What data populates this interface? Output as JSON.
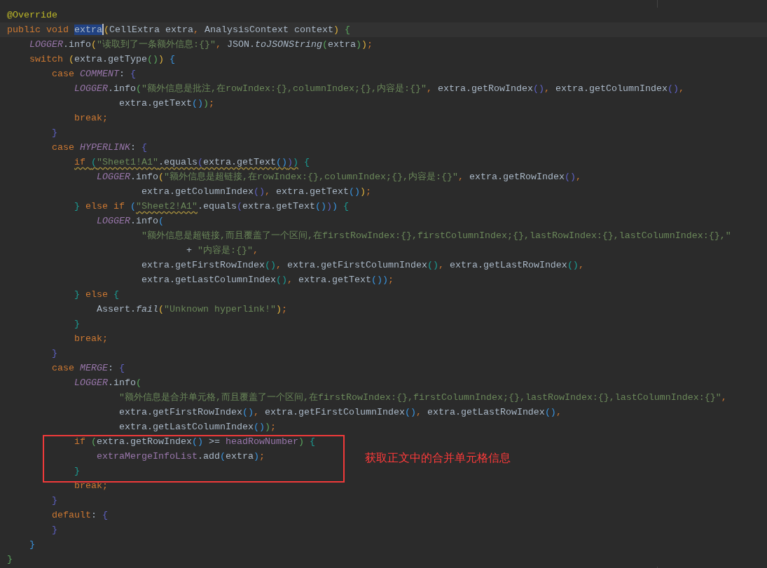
{
  "editor": {
    "lines": [
      {
        "tokens": [
          {
            "kind": "annotation",
            "text": "@Override"
          }
        ]
      },
      {
        "tokens": [
          {
            "kind": "keyword",
            "text": "public void "
          },
          {
            "kind": "selected",
            "text": "extra"
          },
          {
            "kind": "d1",
            "text": "("
          },
          {
            "kind": "plain",
            "text": "CellExtra extra"
          },
          {
            "kind": "keyword",
            "text": ", "
          },
          {
            "kind": "plain",
            "text": "AnalysisContext context"
          },
          {
            "kind": "d1",
            "text": ")"
          },
          {
            "kind": "d2",
            "text": " {"
          }
        ]
      },
      {
        "tokens": [
          {
            "kind": "field",
            "text": "    LOGGER"
          },
          {
            "kind": "plain",
            "text": ".info"
          },
          {
            "kind": "d1",
            "text": "("
          },
          {
            "kind": "string",
            "text": "\"读取到了一条额外信息:{}\""
          },
          {
            "kind": "keyword",
            "text": ", "
          },
          {
            "kind": "plain",
            "text": "JSON."
          },
          {
            "kind": "static",
            "text": "toJSONString"
          },
          {
            "kind": "d2",
            "text": "("
          },
          {
            "kind": "plain",
            "text": "extra"
          },
          {
            "kind": "d2",
            "text": ")"
          },
          {
            "kind": "d1",
            "text": ")"
          },
          {
            "kind": "keyword",
            "text": ";"
          }
        ]
      },
      {
        "tokens": [
          {
            "kind": "keyword",
            "text": "    switch "
          },
          {
            "kind": "d1",
            "text": "("
          },
          {
            "kind": "plain",
            "text": "extra.getType"
          },
          {
            "kind": "d2",
            "text": "()"
          },
          {
            "kind": "d1",
            "text": ")"
          },
          {
            "kind": "d3",
            "text": " {"
          }
        ]
      },
      {
        "tokens": [
          {
            "kind": "keyword",
            "text": "        case "
          },
          {
            "kind": "field",
            "text": "COMMENT"
          },
          {
            "kind": "plain",
            "text": ": "
          },
          {
            "kind": "d4",
            "text": "{"
          }
        ]
      },
      {
        "tokens": [
          {
            "kind": "field",
            "text": "            LOGGER"
          },
          {
            "kind": "plain",
            "text": ".info"
          },
          {
            "kind": "d2",
            "text": "("
          },
          {
            "kind": "string",
            "text": "\"额外信息是批注,在rowIndex:{},columnIndex;{},内容是:{}\""
          },
          {
            "kind": "keyword",
            "text": ", "
          },
          {
            "kind": "plain",
            "text": "extra.getRowIndex"
          },
          {
            "kind": "d4",
            "text": "()"
          },
          {
            "kind": "keyword",
            "text": ", "
          },
          {
            "kind": "plain",
            "text": "extra.getColumnIndex"
          },
          {
            "kind": "d4",
            "text": "()"
          },
          {
            "kind": "keyword",
            "text": ","
          }
        ]
      },
      {
        "tokens": [
          {
            "kind": "plain",
            "text": "                    extra.getText"
          },
          {
            "kind": "d3",
            "text": "()"
          },
          {
            "kind": "d2",
            "text": ")"
          },
          {
            "kind": "keyword",
            "text": ";"
          }
        ]
      },
      {
        "tokens": [
          {
            "kind": "keyword",
            "text": "            break;"
          }
        ]
      },
      {
        "tokens": [
          {
            "kind": "d4",
            "text": "        }"
          }
        ]
      },
      {
        "tokens": [
          {
            "kind": "keyword",
            "text": "        case "
          },
          {
            "kind": "field",
            "text": "HYPERLINK"
          },
          {
            "kind": "plain",
            "text": ": "
          },
          {
            "kind": "d4",
            "text": "{"
          }
        ]
      },
      {
        "tokens": [
          {
            "kind": "keyword_w",
            "text": "            if "
          },
          {
            "kind": "d5_w",
            "text": "("
          },
          {
            "kind": "string_w",
            "text": "\"Sheet1!A1\""
          },
          {
            "kind": "plain_w",
            "text": ".equals"
          },
          {
            "kind": "d4_w",
            "text": "("
          },
          {
            "kind": "plain_w",
            "text": "extra.getText"
          },
          {
            "kind": "d3_w",
            "text": "()"
          },
          {
            "kind": "d4_w",
            "text": ")"
          },
          {
            "kind": "d5_w",
            "text": ")"
          },
          {
            "kind": "d5",
            "text": " {"
          }
        ]
      },
      {
        "tokens": [
          {
            "kind": "field",
            "text": "                LOGGER"
          },
          {
            "kind": "plain",
            "text": ".info"
          },
          {
            "kind": "d1",
            "text": "("
          },
          {
            "kind": "string",
            "text": "\"额外信息是超链接,在rowIndex:{},columnIndex;{},内容是:{}\""
          },
          {
            "kind": "keyword",
            "text": ", "
          },
          {
            "kind": "plain",
            "text": "extra.getRowIndex"
          },
          {
            "kind": "d4",
            "text": "()"
          },
          {
            "kind": "keyword",
            "text": ","
          }
        ]
      },
      {
        "tokens": [
          {
            "kind": "plain",
            "text": "                        extra.getColumnIndex"
          },
          {
            "kind": "d4",
            "text": "()"
          },
          {
            "kind": "keyword",
            "text": ", "
          },
          {
            "kind": "plain",
            "text": "extra.getText"
          },
          {
            "kind": "d3",
            "text": "()"
          },
          {
            "kind": "d1",
            "text": ")"
          },
          {
            "kind": "keyword",
            "text": ";"
          }
        ]
      },
      {
        "tokens": [
          {
            "kind": "d5",
            "text": "            }"
          },
          {
            "kind": "keyword",
            "text": " else if "
          },
          {
            "kind": "d3",
            "text": "("
          },
          {
            "kind": "string_w",
            "text": "\"Sheet2!A1\""
          },
          {
            "kind": "plain",
            "text": ".equals"
          },
          {
            "kind": "d4",
            "text": "("
          },
          {
            "kind": "plain",
            "text": "extra.getText"
          },
          {
            "kind": "d3",
            "text": "()"
          },
          {
            "kind": "d4",
            "text": ")"
          },
          {
            "kind": "d3",
            "text": ")"
          },
          {
            "kind": "d5",
            "text": " {"
          }
        ]
      },
      {
        "tokens": [
          {
            "kind": "field",
            "text": "                LOGGER"
          },
          {
            "kind": "plain",
            "text": ".info"
          },
          {
            "kind": "d3",
            "text": "("
          }
        ]
      },
      {
        "tokens": [
          {
            "kind": "string",
            "text": "                        \"额外信息是超链接,而且覆盖了一个区间,在firstRowIndex:{},firstColumnIndex;{},lastRowIndex:{},lastColumnIndex:{},\""
          }
        ]
      },
      {
        "tokens": [
          {
            "kind": "plain",
            "text": "                                + "
          },
          {
            "kind": "string",
            "text": "\"内容是:{}\""
          },
          {
            "kind": "keyword",
            "text": ","
          }
        ]
      },
      {
        "tokens": [
          {
            "kind": "plain",
            "text": "                        extra.getFirstRowIndex"
          },
          {
            "kind": "d5",
            "text": "()"
          },
          {
            "kind": "keyword",
            "text": ", "
          },
          {
            "kind": "plain",
            "text": "extra.getFirstColumnIndex"
          },
          {
            "kind": "d5",
            "text": "()"
          },
          {
            "kind": "keyword",
            "text": ", "
          },
          {
            "kind": "plain",
            "text": "extra.getLastRowIndex"
          },
          {
            "kind": "d5",
            "text": "()"
          },
          {
            "kind": "keyword",
            "text": ","
          }
        ]
      },
      {
        "tokens": [
          {
            "kind": "plain",
            "text": "                        extra.getLastColumnIndex"
          },
          {
            "kind": "d5",
            "text": "()"
          },
          {
            "kind": "keyword",
            "text": ", "
          },
          {
            "kind": "plain",
            "text": "extra.getText"
          },
          {
            "kind": "d3",
            "text": "()"
          },
          {
            "kind": "d3",
            "text": ")"
          },
          {
            "kind": "keyword",
            "text": ";"
          }
        ]
      },
      {
        "tokens": [
          {
            "kind": "d5",
            "text": "            }"
          },
          {
            "kind": "keyword",
            "text": " else "
          },
          {
            "kind": "d5",
            "text": "{"
          }
        ]
      },
      {
        "tokens": [
          {
            "kind": "plain",
            "text": "                Assert."
          },
          {
            "kind": "static",
            "text": "fail"
          },
          {
            "kind": "d1",
            "text": "("
          },
          {
            "kind": "string",
            "text": "\"Unknown hyperlink!\""
          },
          {
            "kind": "d1",
            "text": ")"
          },
          {
            "kind": "keyword",
            "text": ";"
          }
        ]
      },
      {
        "tokens": [
          {
            "kind": "d5",
            "text": "            }"
          }
        ]
      },
      {
        "tokens": [
          {
            "kind": "keyword",
            "text": "            break;"
          }
        ]
      },
      {
        "tokens": [
          {
            "kind": "d4",
            "text": "        }"
          }
        ]
      },
      {
        "tokens": [
          {
            "kind": "keyword",
            "text": "        case "
          },
          {
            "kind": "field",
            "text": "MERGE"
          },
          {
            "kind": "plain",
            "text": ": "
          },
          {
            "kind": "d4",
            "text": "{"
          }
        ]
      },
      {
        "tokens": [
          {
            "kind": "field",
            "text": "            LOGGER"
          },
          {
            "kind": "plain",
            "text": ".info"
          },
          {
            "kind": "d2",
            "text": "("
          }
        ]
      },
      {
        "tokens": [
          {
            "kind": "string",
            "text": "                    \"额外信息是合并单元格,而且覆盖了一个区间,在firstRowIndex:{},firstColumnIndex;{},lastRowIndex:{},lastColumnIndex:{}\""
          },
          {
            "kind": "keyword",
            "text": ","
          }
        ]
      },
      {
        "tokens": [
          {
            "kind": "plain",
            "text": "                    extra.getFirstRowIndex"
          },
          {
            "kind": "d3",
            "text": "()"
          },
          {
            "kind": "keyword",
            "text": ", "
          },
          {
            "kind": "plain",
            "text": "extra.getFirstColumnIndex"
          },
          {
            "kind": "d3",
            "text": "()"
          },
          {
            "kind": "keyword",
            "text": ", "
          },
          {
            "kind": "plain",
            "text": "extra.getLastRowIndex"
          },
          {
            "kind": "d3",
            "text": "()"
          },
          {
            "kind": "keyword",
            "text": ","
          }
        ]
      },
      {
        "tokens": [
          {
            "kind": "plain",
            "text": "                    extra.getLastColumnIndex"
          },
          {
            "kind": "d3",
            "text": "()"
          },
          {
            "kind": "d2",
            "text": ")"
          },
          {
            "kind": "keyword",
            "text": ";"
          }
        ]
      },
      {
        "tokens": [
          {
            "kind": "keyword",
            "text": "            if "
          },
          {
            "kind": "d2",
            "text": "("
          },
          {
            "kind": "plain",
            "text": "extra.getRowIndex"
          },
          {
            "kind": "d3",
            "text": "()"
          },
          {
            "kind": "plain",
            "text": " >= "
          },
          {
            "kind": "member",
            "text": "headRowNumber"
          },
          {
            "kind": "d2",
            "text": ")"
          },
          {
            "kind": "d5",
            "text": " {"
          }
        ]
      },
      {
        "tokens": [
          {
            "kind": "member",
            "text": "                extraMergeInfoList"
          },
          {
            "kind": "plain",
            "text": ".add"
          },
          {
            "kind": "d3",
            "text": "("
          },
          {
            "kind": "plain",
            "text": "extra"
          },
          {
            "kind": "d3",
            "text": ")"
          },
          {
            "kind": "keyword",
            "text": ";"
          }
        ]
      },
      {
        "tokens": [
          {
            "kind": "d5",
            "text": "            }"
          }
        ]
      },
      {
        "tokens": [
          {
            "kind": "keyword",
            "text": "            break;"
          }
        ]
      },
      {
        "tokens": [
          {
            "kind": "d4",
            "text": "        }"
          }
        ]
      },
      {
        "tokens": [
          {
            "kind": "keyword",
            "text": "        default"
          },
          {
            "kind": "plain",
            "text": ": "
          },
          {
            "kind": "d4",
            "text": "{"
          }
        ]
      },
      {
        "tokens": [
          {
            "kind": "d4",
            "text": "        }"
          }
        ]
      },
      {
        "tokens": [
          {
            "kind": "d3",
            "text": "    }"
          }
        ]
      },
      {
        "tokens": [
          {
            "kind": "d2",
            "text": "}"
          }
        ]
      }
    ]
  },
  "annotation": {
    "text": "获取正文中的合并单元格信息"
  }
}
